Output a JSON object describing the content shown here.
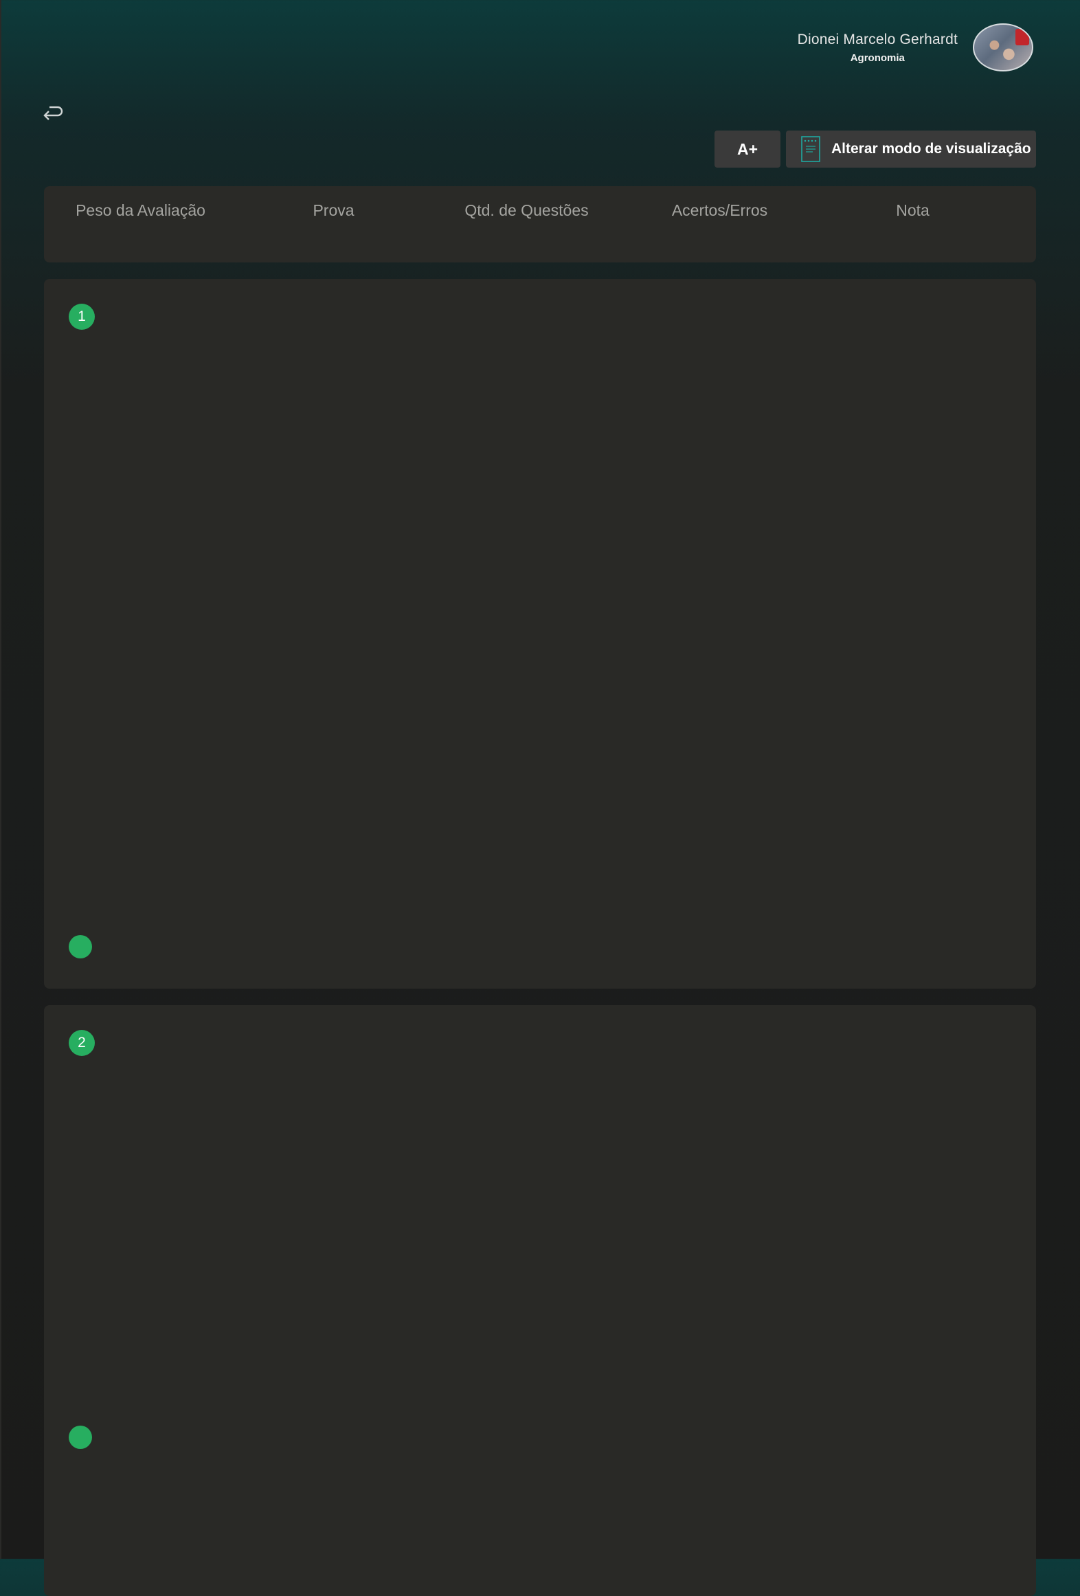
{
  "user": {
    "name": "Dionei Marcelo Gerhardt",
    "course": "Agronomia"
  },
  "icons": {
    "back": "return-arrow-icon",
    "view_mode": "document-icon"
  },
  "toolbar": {
    "font_size_label": "A+",
    "view_mode_label": "Alterar modo de visualização"
  },
  "table_header": {
    "columns": [
      "Peso da Avaliação",
      "Prova",
      "Qtd. de Questões",
      "Acertos/Erros",
      "Nota"
    ]
  },
  "questions": [
    {
      "number": "1"
    },
    {
      "number": "2"
    }
  ],
  "colors": {
    "accent_green": "#27ae60",
    "header_teal": "#0d3b3b",
    "card_bg": "#292926"
  }
}
